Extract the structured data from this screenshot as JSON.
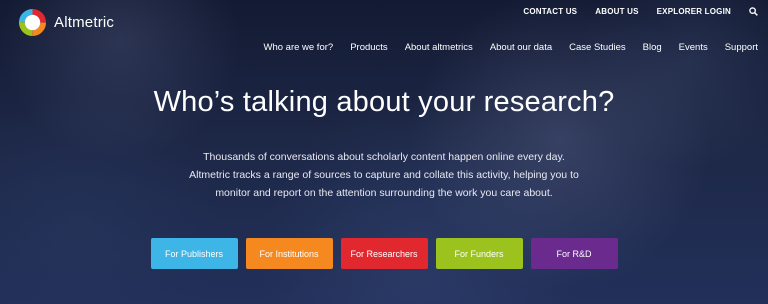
{
  "brand": {
    "name": "Altmetric"
  },
  "top_nav": {
    "items": [
      "CONTACT US",
      "ABOUT US",
      "EXPLORER LOGIN"
    ],
    "search_icon": "search-icon"
  },
  "main_nav": {
    "items": [
      "Who are we for?",
      "Products",
      "About altmetrics",
      "About our data",
      "Case Studies",
      "Blog",
      "Events",
      "Support"
    ]
  },
  "hero": {
    "headline": "Who’s talking about your research?",
    "lede_lines": [
      "Thousands of conversations about scholarly content happen online every day.",
      "Altmetric tracks a range of sources to capture and collate this activity, helping you to",
      "monitor and report on the attention surrounding the work you care about."
    ]
  },
  "cta_buttons": [
    {
      "label": "For Publishers",
      "color": "#3db5e6"
    },
    {
      "label": "For Institutions",
      "color": "#f5891f"
    },
    {
      "label": "For Researchers",
      "color": "#e2282f"
    },
    {
      "label": "For Funders",
      "color": "#9cc31d"
    },
    {
      "label": "For R&D",
      "color": "#6a2a8e"
    }
  ]
}
